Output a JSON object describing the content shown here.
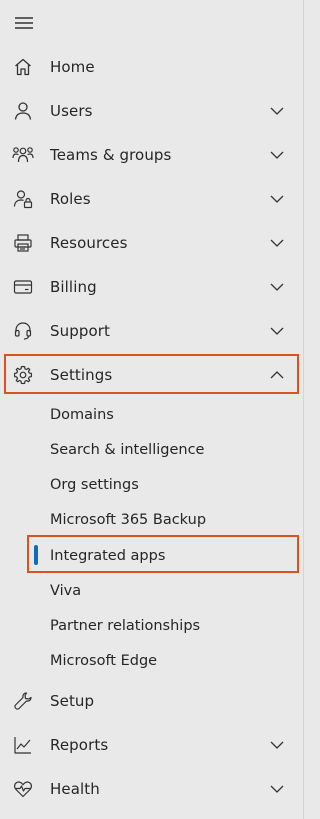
{
  "nav": {
    "items": [
      {
        "key": "home",
        "label": "Home",
        "icon": "home-icon",
        "expandable": false
      },
      {
        "key": "users",
        "label": "Users",
        "icon": "user-icon",
        "expandable": true
      },
      {
        "key": "teams",
        "label": "Teams & groups",
        "icon": "people-team-icon",
        "expandable": true
      },
      {
        "key": "roles",
        "label": "Roles",
        "icon": "person-lock-icon",
        "expandable": true
      },
      {
        "key": "resources",
        "label": "Resources",
        "icon": "printer-icon",
        "expandable": true
      },
      {
        "key": "billing",
        "label": "Billing",
        "icon": "credit-card-icon",
        "expandable": true
      },
      {
        "key": "support",
        "label": "Support",
        "icon": "headset-icon",
        "expandable": true
      },
      {
        "key": "settings",
        "label": "Settings",
        "icon": "gear-icon",
        "expandable": true,
        "expanded": true
      }
    ],
    "settings_children": [
      {
        "label": "Domains"
      },
      {
        "label": "Search & intelligence"
      },
      {
        "label": "Org settings"
      },
      {
        "label": "Microsoft 365 Backup"
      },
      {
        "label": "Integrated apps",
        "selected": true
      },
      {
        "label": "Viva"
      },
      {
        "label": "Partner relationships"
      },
      {
        "label": "Microsoft Edge"
      }
    ],
    "bottom_items": [
      {
        "key": "setup",
        "label": "Setup",
        "icon": "wrench-icon",
        "expandable": false
      },
      {
        "key": "reports",
        "label": "Reports",
        "icon": "line-chart-icon",
        "expandable": true
      },
      {
        "key": "health",
        "label": "Health",
        "icon": "heart-pulse-icon",
        "expandable": true
      }
    ]
  },
  "colors": {
    "background": "#e9e9e9",
    "text": "#262626",
    "highlight_border": "#d9531e",
    "selected_indicator": "#0f6cbd"
  }
}
